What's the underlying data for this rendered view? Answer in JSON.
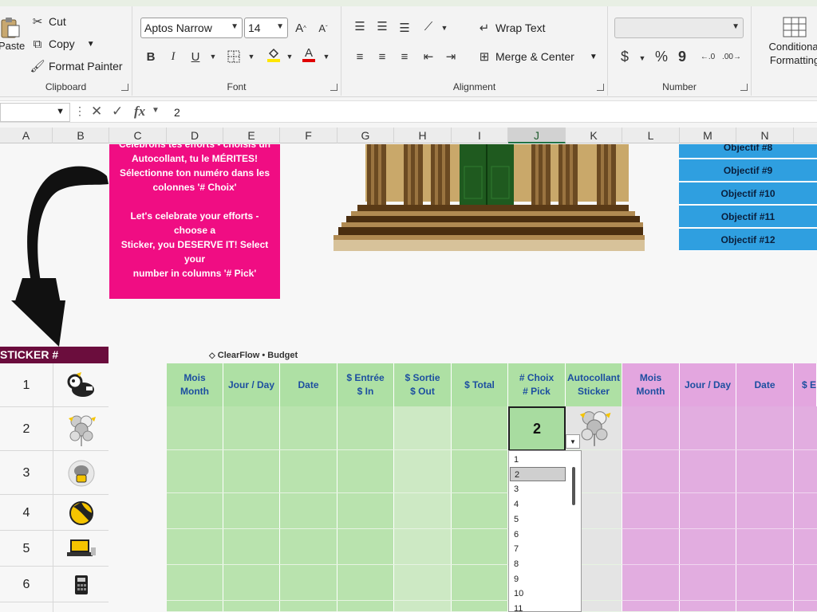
{
  "ribbon": {
    "clipboard": {
      "paste": "Paste",
      "cut": "Cut",
      "copy": "Copy",
      "format_painter": "Format Painter",
      "label": "Clipboard"
    },
    "font": {
      "family": "Aptos Narrow",
      "size": "14",
      "label": "Font"
    },
    "alignment": {
      "wrap_text": "Wrap Text",
      "merge_center": "Merge & Center",
      "label": "Alignment"
    },
    "number": {
      "format": "",
      "label": "Number",
      "currency": "$",
      "percent": "%",
      "comma": "9"
    },
    "styles": {
      "conditional_formatting": "Conditional Formatting"
    }
  },
  "formula_bar": {
    "name_box": "",
    "fx": "fx",
    "value": "2"
  },
  "columns": [
    "A",
    "B",
    "C",
    "D",
    "E",
    "F",
    "G",
    "H",
    "I",
    "J",
    "K",
    "L",
    "M",
    "N"
  ],
  "active_column": "J",
  "note": {
    "lines_fr": [
      "Célébrons tes efforts - choisis un",
      "Autocollant, tu le MÉRITES!",
      "Sélectionne ton numéro dans les",
      "colonnes '# Choix'"
    ],
    "lines_en": [
      "Let's celebrate your efforts - choose a",
      "Sticker, you DESERVE IT! Select your",
      "number in columns '# Pick'"
    ]
  },
  "objectives": [
    "Objectif #8",
    "Objectif #9",
    "Objectif #10",
    "Objectif #11",
    "Objectif #12"
  ],
  "sticker_table": {
    "header": "STICKER #",
    "rows": [
      {
        "num": "1",
        "icon": "cow-sticker-icon"
      },
      {
        "num": "2",
        "icon": "balloons-sticker-icon"
      },
      {
        "num": "3",
        "icon": "piggy-sticker-icon"
      },
      {
        "num": "4",
        "icon": "ball-sticker-icon"
      },
      {
        "num": "5",
        "icon": "laptop-sticker-icon"
      },
      {
        "num": "6",
        "icon": "calculator-sticker-icon"
      }
    ]
  },
  "brand": "ClearFlow • Budget",
  "budget_headers_green": [
    [
      "Mois",
      "Month"
    ],
    [
      "Jour / Day"
    ],
    [
      "Date"
    ],
    [
      "$ Entrée",
      "$ In"
    ],
    [
      "$ Sortie",
      "$ Out"
    ],
    [
      "$ Total"
    ],
    [
      "# Choix",
      "# Pick"
    ],
    [
      "Autocollant",
      "Sticker"
    ]
  ],
  "budget_headers_pink": [
    [
      "Mois",
      "Month"
    ],
    [
      "Jour / Day"
    ],
    [
      "Date"
    ],
    [
      "$ En"
    ]
  ],
  "selected_cell_value": "2",
  "dropdown_options": [
    "1",
    "2",
    "3",
    "4",
    "5",
    "6",
    "7",
    "8",
    "9",
    "10",
    "11"
  ],
  "dropdown_selected": "2"
}
